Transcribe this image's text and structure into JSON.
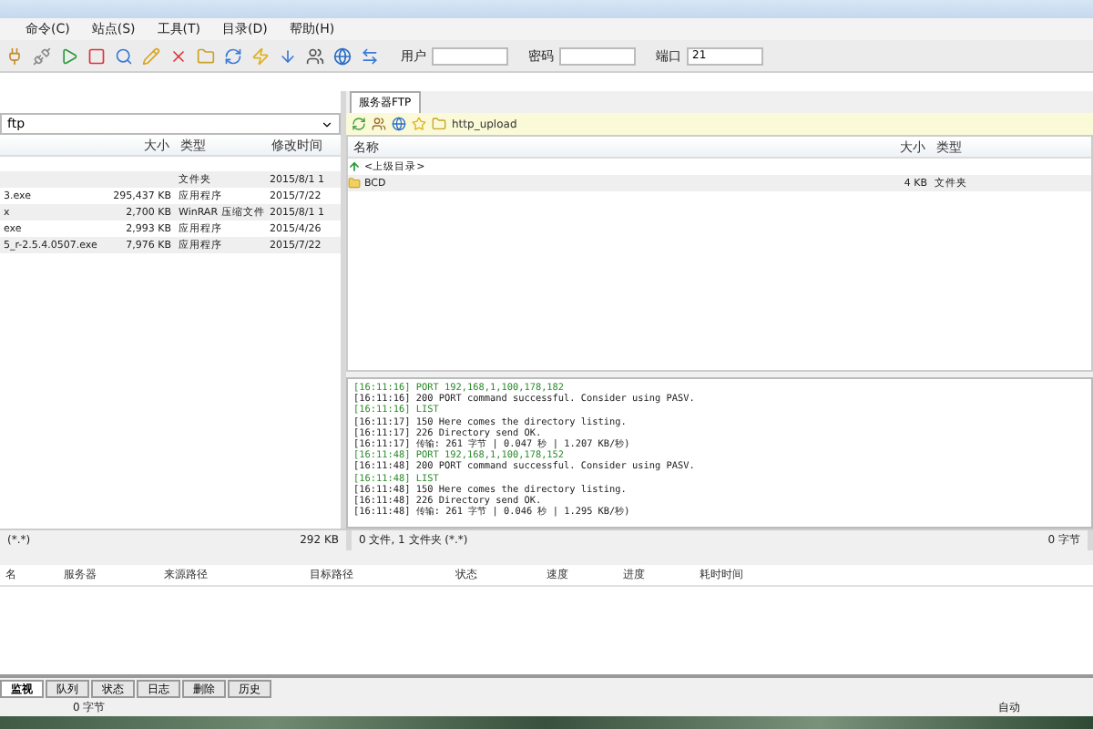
{
  "menu": [
    "命令(C)",
    "站点(S)",
    "工具(T)",
    "目录(D)",
    "帮助(H)"
  ],
  "connect_fields": [
    {
      "label": "用户"
    },
    {
      "label": "密码"
    },
    {
      "label": "端口",
      "value": "21"
    }
  ],
  "local": {
    "path": "ftp",
    "columns": [
      "大小",
      "类型",
      "修改时间"
    ],
    "rows": [
      {
        "name": "",
        "size": "",
        "type": "文件夹",
        "modified": "2015/8/1 1"
      },
      {
        "name": "3.exe",
        "size": "295,437 KB",
        "type": "应用程序",
        "modified": "2015/7/22"
      },
      {
        "name": "x",
        "size": "2,700 KB",
        "type": "WinRAR 压缩文件",
        "modified": "2015/8/1 1"
      },
      {
        "name": "exe",
        "size": "2,993 KB",
        "type": "应用程序",
        "modified": "2015/4/26"
      },
      {
        "name": "5_r-2.5.4.0507.exe",
        "size": "7,976 KB",
        "type": "应用程序",
        "modified": "2015/7/22"
      }
    ],
    "status_left": "(*.*)",
    "status_right": "292 KB"
  },
  "remote": {
    "tab": "服务器FTP",
    "path": "http_upload",
    "columns": [
      "名称",
      "大小",
      "类型"
    ],
    "rows": [
      {
        "kind": "parent",
        "name": "<上级目录>",
        "size": "",
        "type": ""
      },
      {
        "kind": "folder",
        "name": "BCD",
        "size": "4 KB",
        "type": "文件夹"
      }
    ],
    "status_left": "0 文件, 1 文件夹 (*.*)",
    "status_right": "0 字节"
  },
  "log": [
    {
      "kind": "command",
      "time": "[16:11:16]",
      "text": "PORT 192,168,1,100,178,182"
    },
    {
      "kind": "reply",
      "time": "[16:11:16]",
      "text": "200 PORT command successful. Consider using PASV."
    },
    {
      "kind": "command",
      "time": "[16:11:16]",
      "text": "LIST"
    },
    {
      "kind": "reply",
      "time": "[16:11:17]",
      "text": "150 Here comes the directory listing."
    },
    {
      "kind": "reply",
      "time": "[16:11:17]",
      "text": "226 Directory send OK."
    },
    {
      "kind": "reply",
      "time": "[16:11:17]",
      "text": "传输: 261 字节 | 0.047 秒 | 1.207 KB/秒)"
    },
    {
      "kind": "command",
      "time": "[16:11:48]",
      "text": "PORT 192,168,1,100,178,152"
    },
    {
      "kind": "reply",
      "time": "[16:11:48]",
      "text": "200 PORT command successful. Consider using PASV."
    },
    {
      "kind": "command",
      "time": "[16:11:48]",
      "text": "LIST"
    },
    {
      "kind": "reply",
      "time": "[16:11:48]",
      "text": "150 Here comes the directory listing."
    },
    {
      "kind": "reply",
      "time": "[16:11:48]",
      "text": "226 Directory send OK."
    },
    {
      "kind": "reply",
      "time": "[16:11:48]",
      "text": "传输: 261 字节 | 0.046 秒 | 1.295 KB/秒)"
    }
  ],
  "queue_columns": [
    "名",
    "服务器",
    "来源路径",
    "目标路径",
    "状态",
    "速度",
    "进度",
    "耗时时间"
  ],
  "bottom_tabs": [
    {
      "label": "监视",
      "selected": true
    },
    {
      "label": "队列",
      "selected": false
    },
    {
      "label": "状态",
      "selected": false
    },
    {
      "label": "日志",
      "selected": false
    },
    {
      "label": "删除",
      "selected": false
    },
    {
      "label": "历史",
      "selected": false
    }
  ],
  "status_bar": {
    "left": "0 字节",
    "right": "自动"
  }
}
